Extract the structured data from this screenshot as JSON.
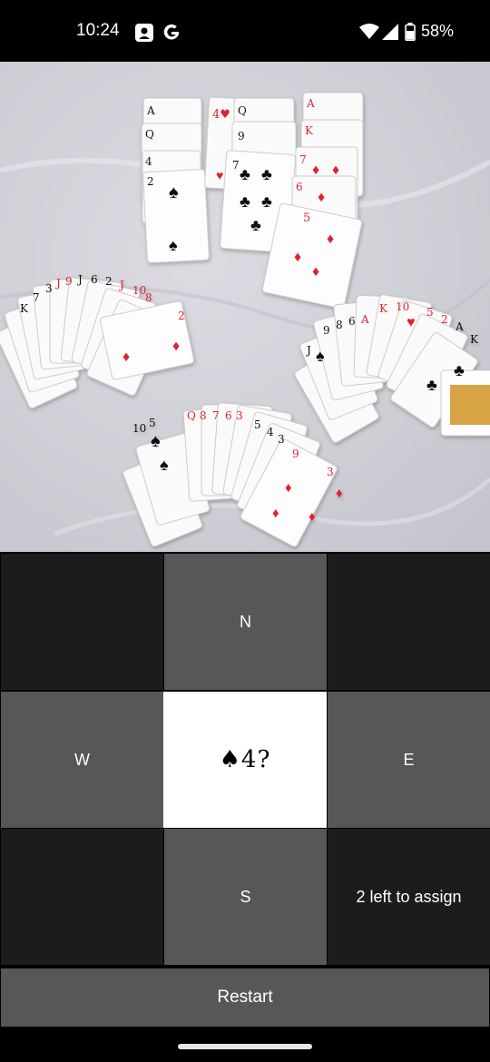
{
  "status_bar": {
    "time": "10:24",
    "battery": "58%",
    "icons": [
      "assistant-icon",
      "google-icon",
      "wifi-icon",
      "signal-icon",
      "battery-icon"
    ]
  },
  "photo": {
    "description_icon": "playing-cards-photo"
  },
  "grid": {
    "north": "N",
    "west": "W",
    "east": "E",
    "south": "S",
    "center_card": "♠4?",
    "remaining": "2 left to assign"
  },
  "restart_label": "Restart",
  "colors": {
    "dark_cell": "#1c1c1c",
    "mid_cell": "#575757",
    "center_cell": "#ffffff",
    "card_red": "#e1212e",
    "card_black": "#111111"
  }
}
